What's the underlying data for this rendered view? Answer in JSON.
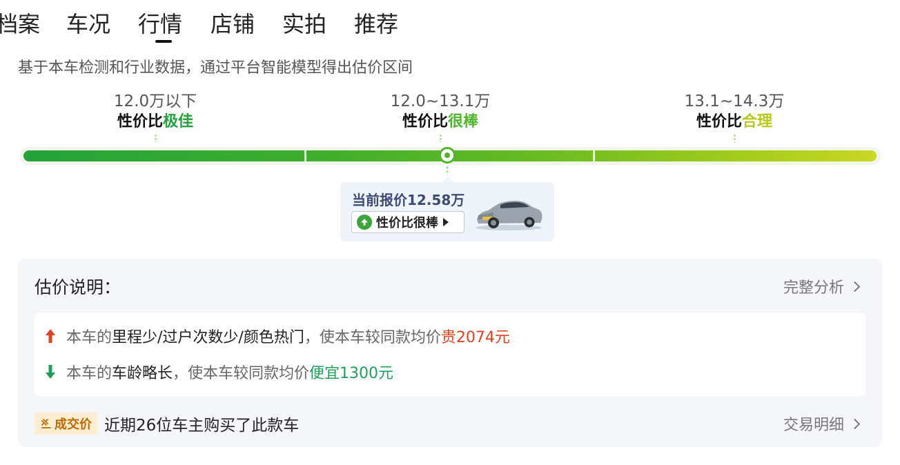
{
  "tabs": [
    "档案",
    "车况",
    "行情",
    "店铺",
    "实拍",
    "推荐"
  ],
  "active_tab": "行情",
  "subtitle": "基于本车检测和行业数据，通过平台智能模型得出估价区间",
  "ranges": [
    {
      "price": "12.0万以下",
      "label_prefix": "性价比",
      "label_highlight": "极佳"
    },
    {
      "price": "12.0~13.1万",
      "label_prefix": "性价比",
      "label_highlight": "很棒"
    },
    {
      "price": "13.1~14.3万",
      "label_prefix": "性价比",
      "label_highlight": "合理"
    }
  ],
  "current": {
    "title": "当前报价12.58万",
    "badge": "性价比很棒"
  },
  "explain": {
    "title": "估价说明：",
    "full_analysis": "完整分析",
    "reasons": [
      {
        "prefix": "本车的",
        "factors": "里程少/过户次数少/颜色热门",
        "middle": "，使本车较同款均价",
        "impact": "贵2074元",
        "direction": "up"
      },
      {
        "prefix": "本车的",
        "factors": "车龄略长",
        "middle": "，使本车较同款均价",
        "impact": "便宜1300元",
        "direction": "down"
      }
    ],
    "deal_badge": "成交价",
    "deal_text": "近期26位车主购买了此款车",
    "deal_link": "交易明细"
  },
  "colors": {
    "best": "#23a23a",
    "good": "#4fb52a",
    "ok": "#b9c91a",
    "up": "#e0421f",
    "down": "#1ea05a"
  }
}
